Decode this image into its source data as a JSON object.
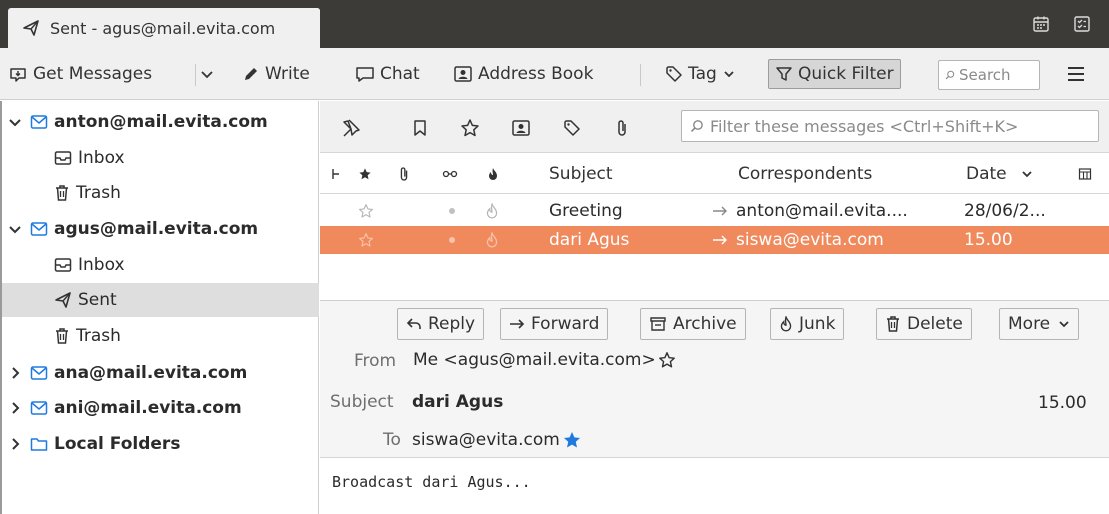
{
  "tab": {
    "title": "Sent - agus@mail.evita.com"
  },
  "toolbar": {
    "get_messages": "Get Messages",
    "write": "Write",
    "chat": "Chat",
    "address_book": "Address Book",
    "tag": "Tag",
    "quick_filter": "Quick Filter",
    "search_placeholder": "Search"
  },
  "folders": {
    "acct1": {
      "name": "anton@mail.evita.com",
      "inbox": "Inbox",
      "trash": "Trash"
    },
    "acct2": {
      "name": "agus@mail.evita.com",
      "inbox": "Inbox",
      "sent": "Sent",
      "trash": "Trash"
    },
    "acct3": {
      "name": "ana@mail.evita.com"
    },
    "acct4": {
      "name": "ani@mail.evita.com"
    },
    "local": {
      "name": "Local Folders"
    }
  },
  "filter": {
    "placeholder": "Filter these messages <Ctrl+Shift+K>"
  },
  "columns": {
    "subject": "Subject",
    "correspondents": "Correspondents",
    "date": "Date"
  },
  "messages": [
    {
      "subject": "Greeting",
      "correspondent": "anton@mail.evita....",
      "date": "28/06/2..."
    },
    {
      "subject": "dari Agus",
      "correspondent": "siswa@evita.com",
      "date": "15.00"
    }
  ],
  "actions": {
    "reply": "Reply",
    "forward": "Forward",
    "archive": "Archive",
    "junk": "Junk",
    "delete": "Delete",
    "more": "More"
  },
  "message": {
    "from_label": "From",
    "from_value": "Me <agus@mail.evita.com>",
    "subject_label": "Subject",
    "subject_value": "dari Agus",
    "time": "15.00",
    "to_label": "To",
    "to_value": "siswa@evita.com",
    "body": "Broadcast dari Agus..."
  },
  "colors": {
    "selection": "#f08a5d",
    "titlebar": "#3c3b37",
    "star_blue": "#1f7ae0"
  }
}
